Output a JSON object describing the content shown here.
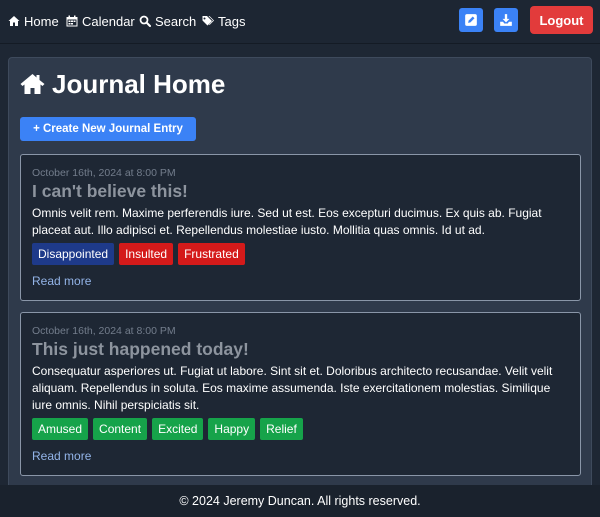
{
  "nav": {
    "home": "Home",
    "calendar": "Calendar",
    "search": "Search",
    "tags": "Tags",
    "logout": "Logout"
  },
  "main": {
    "title": "Journal Home",
    "create_button": "+ Create New Journal Entry"
  },
  "entries": [
    {
      "date": "October 16th, 2024 at 8:00 PM",
      "title": "I can't believe this!",
      "body": "Omnis velit rem. Maxime perferendis iure. Sed ut est. Eos excepturi ducimus. Ex quis ab. Fugiat placeat aut. Illo adipisci et. Repellendus molestiae iusto. Mollitia quas omnis. Id ut ad.",
      "tags": [
        {
          "label": "Disappointed",
          "color": "#1e3a8a"
        },
        {
          "label": "Insulted",
          "color": "#d41a1a"
        },
        {
          "label": "Frustrated",
          "color": "#d41a1a"
        }
      ],
      "read_more": "Read more"
    },
    {
      "date": "October 16th, 2024 at 8:00 PM",
      "title": "This just happened today!",
      "body": "Consequatur asperiores ut. Fugiat ut labore. Sint sit et. Doloribus architecto recusandae. Velit velit aliquam. Repellendus in soluta. Eos maxime assumenda. Iste exercitationem molestias. Similique iure omnis. Nihil perspiciatis sit.",
      "tags": [
        {
          "label": "Amused",
          "color": "#16a34a"
        },
        {
          "label": "Content",
          "color": "#16a34a"
        },
        {
          "label": "Excited",
          "color": "#16a34a"
        },
        {
          "label": "Happy",
          "color": "#16a34a"
        },
        {
          "label": "Relief",
          "color": "#16a34a"
        }
      ],
      "read_more": "Read more"
    }
  ],
  "footer": {
    "text": "© 2024 Jeremy Duncan. All rights reserved."
  },
  "colors": {
    "accent": "#3b82f6",
    "logout": "#e23b3b",
    "background": "#1e2734",
    "panel": "#2f3a4b"
  },
  "icons": {
    "home": "home-icon",
    "calendar": "calendar-icon",
    "search": "search-icon",
    "tags": "tags-icon",
    "edit": "edit-icon",
    "download": "download-icon"
  }
}
